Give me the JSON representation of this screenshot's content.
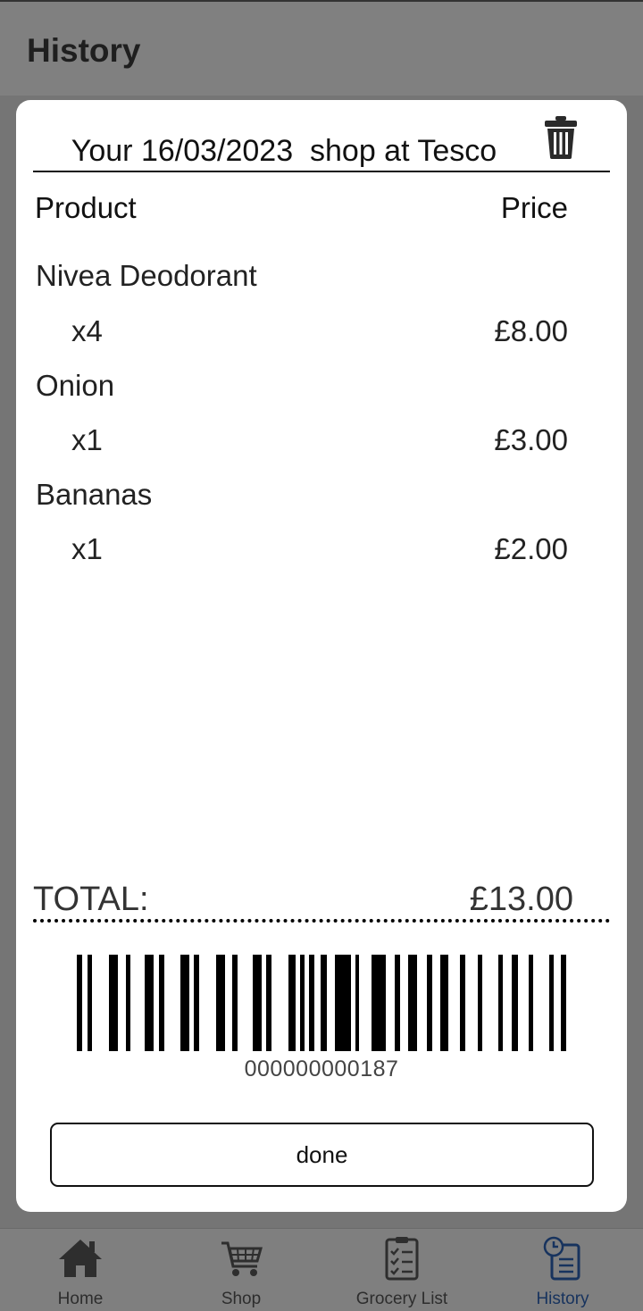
{
  "header": {
    "title": "History"
  },
  "receipt": {
    "title": "Your 16/03/2023  shop at Tesco",
    "columns": {
      "product": "Product",
      "price": "Price"
    },
    "items": [
      {
        "name": "Nivea Deodorant",
        "qty": "x4",
        "price": "£8.00"
      },
      {
        "name": "Onion",
        "qty": "x1",
        "price": "£3.00"
      },
      {
        "name": "Bananas",
        "qty": "x1",
        "price": "£2.00"
      }
    ],
    "total_label": "TOTAL:",
    "total_value": "£13.00",
    "barcode_number": "000000000187",
    "done_label": "done",
    "delete_icon": "trash-icon"
  },
  "nav": {
    "items": [
      {
        "label": "Home",
        "icon": "home-icon"
      },
      {
        "label": "Shop",
        "icon": "cart-icon"
      },
      {
        "label": "Grocery List",
        "icon": "clipboard-list-icon"
      },
      {
        "label": "History",
        "icon": "history-icon",
        "active": true
      }
    ],
    "active_color": "#17335e"
  }
}
